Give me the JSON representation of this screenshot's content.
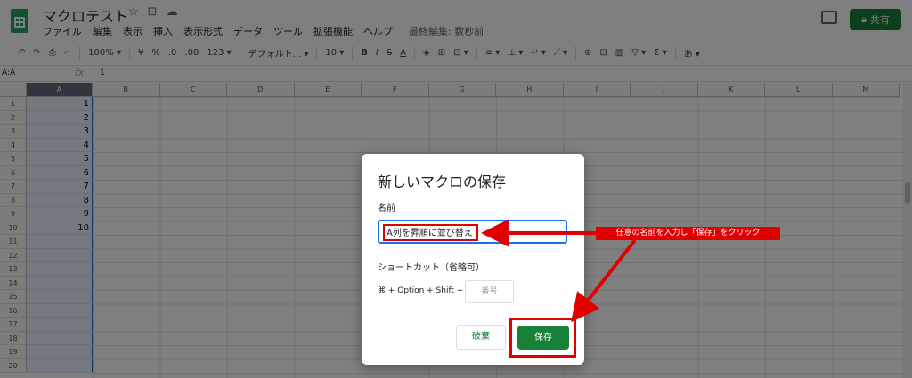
{
  "header": {
    "doc_title": "マクロテスト",
    "title_icons": [
      "☆",
      "⊡",
      "☁"
    ],
    "menu": [
      "ファイル",
      "編集",
      "表示",
      "挿入",
      "表示形式",
      "データ",
      "ツール",
      "拡張機能",
      "ヘルプ"
    ],
    "last_edit": "最終編集: 数秒前",
    "share_label": "共有"
  },
  "toolbar": {
    "undo": "↶",
    "redo": "↷",
    "print": "⎙",
    "paint_format": "⌐",
    "zoom": "100% ▾",
    "currency": "¥",
    "percent": "%",
    "decrease_decimal": ".0",
    "increase_decimal": ".00",
    "number_format": "123 ▾",
    "font": "デフォルト... ▾",
    "font_size": "10 ▾",
    "bold": "B",
    "italic": "I",
    "strikethrough": "S",
    "text_color": "A",
    "fill": "◈",
    "borders": "⊞",
    "merge": "⊟ ▾",
    "halign": "≡ ▾",
    "valign": "⊥ ▾",
    "wrap": "↵ ▾",
    "rotate": "⟋ ▾",
    "link": "⊕",
    "comment": "⊡",
    "chart": "▥",
    "filter": "▽ ▾",
    "functions": "Σ ▾",
    "input_tools": "あ ▾"
  },
  "formula_bar": {
    "name_box": "A:A",
    "fx": "fx",
    "value": "1"
  },
  "columns": [
    "A",
    "B",
    "C",
    "D",
    "E",
    "F",
    "G",
    "H",
    "I",
    "J",
    "K",
    "L",
    "M"
  ],
  "rows": [
    "1",
    "2",
    "3",
    "4",
    "5",
    "6",
    "7",
    "8",
    "9",
    "10",
    "11",
    "12",
    "13",
    "14",
    "15",
    "16",
    "17",
    "18",
    "19",
    "20"
  ],
  "column_a_values": [
    "1",
    "2",
    "3",
    "4",
    "5",
    "6",
    "7",
    "8",
    "9",
    "10"
  ],
  "dialog": {
    "title": "新しいマクロの保存",
    "name_label": "名前",
    "name_value": "A列を昇順に並び替え",
    "shortcut_label": "ショートカット（省略可）",
    "shortcut_combo": "⌘ + Option + Shift +",
    "shortcut_placeholder": "番号",
    "cancel_label": "破棄",
    "save_label": "保存"
  },
  "annotation": {
    "text": "任意の名前を入力し「保存」をクリック",
    "color": "#e00000"
  },
  "colors": {
    "brand_green": "#188038",
    "sheets_green": "#23a566",
    "focus_blue": "#1a73e8"
  }
}
